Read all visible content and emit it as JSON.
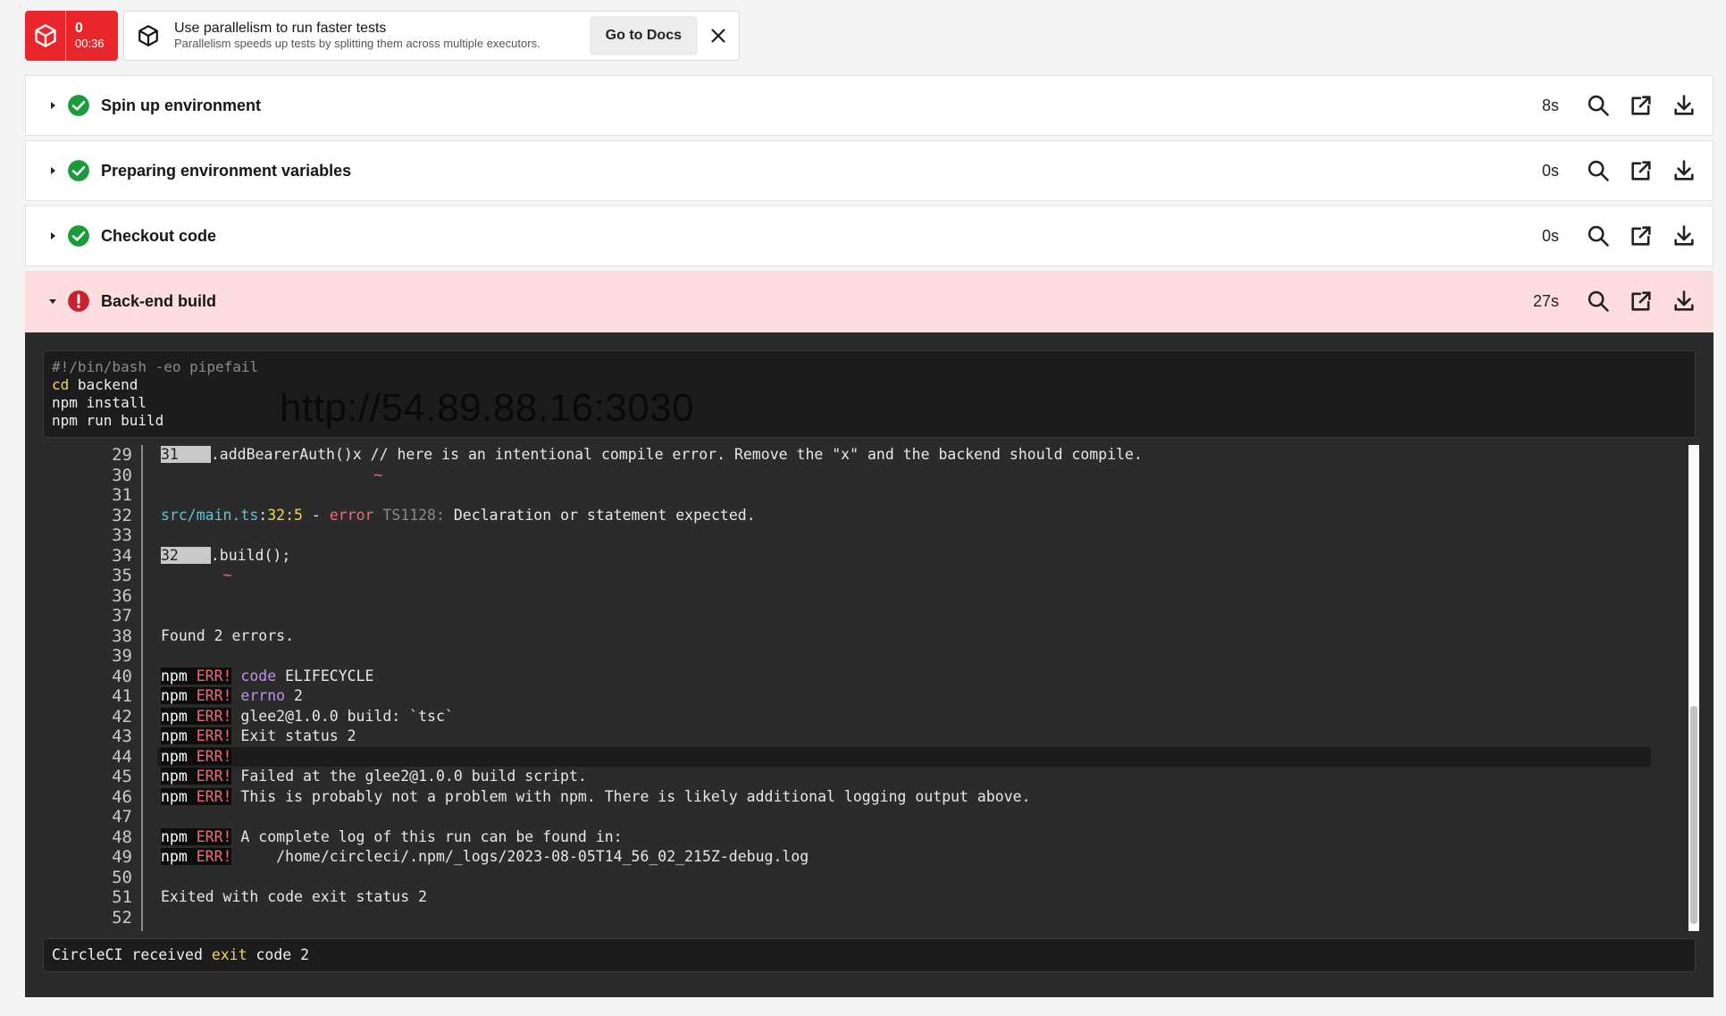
{
  "status": {
    "count": "0",
    "time": "00:36",
    "color": "#e8262c",
    "icon": "package-icon"
  },
  "tip": {
    "title": "Use parallelism to run faster tests",
    "subtitle": "Parallelism speeds up tests by splitting them across multiple executors.",
    "docs_label": "Go to Docs",
    "icon": "cube-icon"
  },
  "steps": [
    {
      "name": "Spin up environment",
      "duration": "8s",
      "state": "success"
    },
    {
      "name": "Preparing environment variables",
      "duration": "0s",
      "state": "success"
    },
    {
      "name": "Checkout code",
      "duration": "0s",
      "state": "success"
    },
    {
      "name": "Back-end build",
      "duration": "27s",
      "state": "failed"
    }
  ],
  "command": {
    "shebang": "#!/bin/bash -eo pipefail",
    "cd_kw": "cd",
    "cd_arg": " backend",
    "line3": "npm install",
    "line4": "npm run build"
  },
  "watermark": "http://54.89.88.16:3030",
  "log": {
    "line_numbers": [
      "29",
      "30",
      "31",
      "32",
      "33",
      "34",
      "35",
      "36",
      "37",
      "38",
      "39",
      "40",
      "41",
      "42",
      "43",
      "44",
      "45",
      "46",
      "47",
      "48",
      "49",
      "50",
      "51",
      "52"
    ],
    "l29_num": "31",
    "l29_text": ".addBearerAuth()x // here is an intentional compile error. Remove the \"x\" and the backend should compile.",
    "l30_squig": "~",
    "l32_file": "src/main.ts",
    "l32_sep": ":",
    "l32_pos": "32:5",
    "l32_dash": " - ",
    "l32_error": "error",
    "l32_code": " TS1128:",
    "l32_msg": " Declaration or statement expected.",
    "l34_num": "32",
    "l34_text": ".build();",
    "l35_squig": "~",
    "l38_text": "Found 2 errors.",
    "npm": "npm",
    "err": " ERR!",
    "l40_key": "code",
    "l40_val": " ELIFECYCLE",
    "l41_key": "errno",
    "l41_val": " 2",
    "l42_text": " glee2@1.0.0 build: `tsc`",
    "l43_text": " Exit status 2",
    "l45_text": " Failed at the glee2@1.0.0 build script.",
    "l46_text": " This is probably not a problem with npm. There is likely additional logging output above.",
    "l48_text": " A complete log of this run can be found in:",
    "l49_text": "     /home/circleci/.npm/_logs/2023-08-05T14_56_02_215Z-debug.log",
    "l51_text": "Exited with code exit status 2"
  },
  "footer": {
    "pre": "CircleCI received ",
    "kw": "exit",
    "post": " code 2"
  },
  "colors": {
    "success": "#1a9b3c",
    "failed": "#c8202f",
    "failed_row_bg": "#fddcdf",
    "log_bg": "#2b2b2b"
  }
}
